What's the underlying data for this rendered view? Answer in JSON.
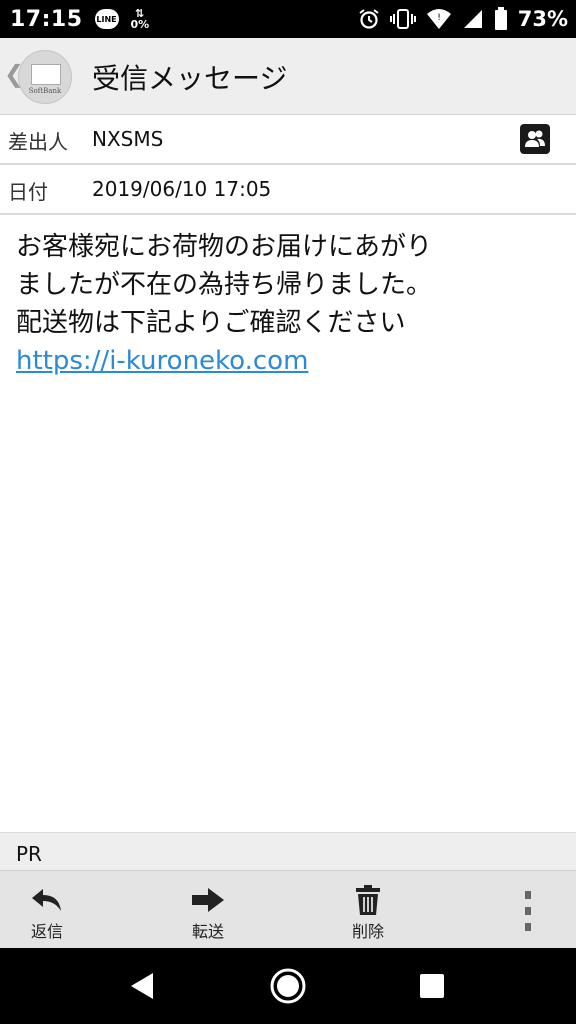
{
  "status_bar": {
    "time": "17:15",
    "line_badge": "LINE",
    "data_usage": "0%",
    "battery": "73%",
    "icons": [
      "line-icon",
      "data-usage-icon",
      "alarm-icon",
      "vibrate-icon",
      "wifi-icon",
      "signal-icon",
      "battery-icon"
    ]
  },
  "header": {
    "title": "受信メッセージ",
    "app_brand": "SoftBank",
    "back_icon": "chevron-left-icon"
  },
  "meta": {
    "sender_label": "差出人",
    "sender_value": "NXSMS",
    "date_label": "日付",
    "date_value": "2019/06/10 17:05"
  },
  "message": {
    "lines": [
      "お客様宛にお荷物のお届けにあがり",
      "ましたが不在の為持ち帰りました。",
      "配送物は下記よりご確認ください"
    ],
    "link": "https://i-kuroneko.com"
  },
  "pr": {
    "label": "PR"
  },
  "toolbar": {
    "reply_label": "返信",
    "forward_label": "転送",
    "delete_label": "削除"
  },
  "colors": {
    "link": "#2a8ad7",
    "header_bg": "#eeeeee",
    "toolbar_bg": "#e4e4e4"
  }
}
